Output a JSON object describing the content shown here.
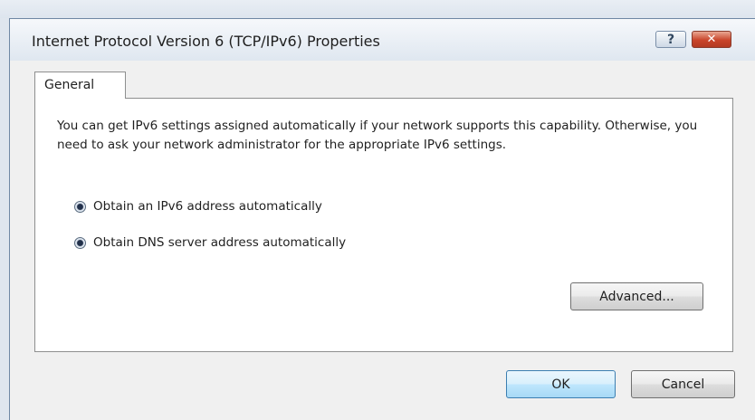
{
  "window": {
    "title": "Internet Protocol Version 6 (TCP/IPv6) Properties",
    "help_glyph": "?",
    "close_glyph": "✕"
  },
  "tabs": [
    {
      "label": "General",
      "selected": true
    }
  ],
  "general": {
    "description": "You can get IPv6 settings assigned automatically if your network supports this capability. Otherwise, you need to ask your network administrator for the appropriate IPv6 settings.",
    "options": [
      {
        "label": "Obtain an IPv6 address automatically",
        "selected": true
      },
      {
        "label": "Obtain DNS server address automatically",
        "selected": true
      }
    ],
    "advanced_label": "Advanced..."
  },
  "footer": {
    "ok_label": "OK",
    "cancel_label": "Cancel"
  }
}
